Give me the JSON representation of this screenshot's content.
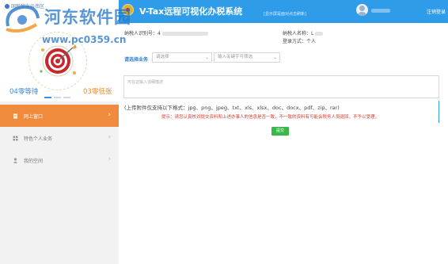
{
  "left_panel": {
    "brand_text": "国税税友云南区",
    "stat_waiting": "04零等待",
    "stat_cheap": "03零低张"
  },
  "menu": {
    "items": [
      {
        "label": "网上窗口",
        "icon": "document-icon"
      },
      {
        "label": "特色个人业务",
        "icon": "grid-icon"
      },
      {
        "label": "我的空间",
        "icon": "person-icon"
      }
    ]
  },
  "header": {
    "title": "V-Tax远程可视化办税系统",
    "link_text": "[显示屏是面对点击刷新]",
    "logout_label": "注销登录"
  },
  "taxpayer": {
    "id_label": "纳税人识别号：4",
    "name_label": "纳税人名称：",
    "name_value": "L",
    "login_label": "登录方式：个人"
  },
  "form": {
    "biz_label": "请选择业务",
    "select1_placeholder": "请选择",
    "select2_placeholder": "输入关键字可筛选",
    "textarea_placeholder": "可在这输入详细描述",
    "upload_note": "(上传附件仅支持以下格式：jpg、png、jpeg、txt、xls、xlsx、doc、docx、pdf、zip、rar)",
    "notice": "提示：请您认真核对提交资料和上述办事人的信息是否一致，不一致的资料有可能会税务人员退回，不予以受理。",
    "submit_label": "提交"
  },
  "watermark": {
    "text": "河东软件园",
    "url": "www.pc0359.cn"
  },
  "colors": {
    "header_bg": "#2e9ce8",
    "menu_active": "#f08a3c",
    "notice": "#d83a2c",
    "submit": "#3cb84a"
  }
}
